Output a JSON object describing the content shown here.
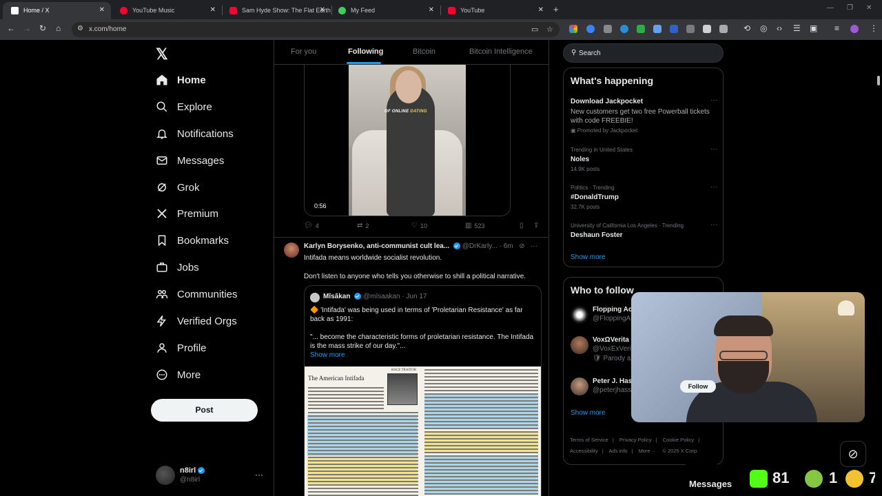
{
  "browser": {
    "tabs": [
      {
        "label": "Home / X",
        "icon": "x-logo-icon",
        "color": "#ffffff"
      },
      {
        "label": "YouTube Music",
        "icon": "youtube-music-icon",
        "color": "#ff0033"
      },
      {
        "label": "Sam Hyde Show: The Flat Earth",
        "icon": "youtube-icon",
        "color": "#ff0033"
      },
      {
        "label": "My Feed",
        "icon": "feed-play-icon",
        "color": "#3ecf5a"
      },
      {
        "label": "YouTube",
        "icon": "youtube-icon",
        "color": "#ff0033"
      }
    ],
    "new_tab": "+",
    "url": "x.com/home"
  },
  "sidebar": {
    "logo": "𝕏",
    "items": [
      {
        "label": "Home",
        "icon": "home-icon"
      },
      {
        "label": "Explore",
        "icon": "search-icon"
      },
      {
        "label": "Notifications",
        "icon": "bell-icon"
      },
      {
        "label": "Messages",
        "icon": "envelope-icon"
      },
      {
        "label": "Grok",
        "icon": "grok-icon"
      },
      {
        "label": "Premium",
        "icon": "x-premium-icon"
      },
      {
        "label": "Bookmarks",
        "icon": "bookmark-icon"
      },
      {
        "label": "Jobs",
        "icon": "briefcase-icon"
      },
      {
        "label": "Communities",
        "icon": "people-icon"
      },
      {
        "label": "Verified Orgs",
        "icon": "lightning-icon"
      },
      {
        "label": "Profile",
        "icon": "person-icon"
      },
      {
        "label": "More",
        "icon": "more-circle-icon"
      }
    ],
    "post_label": "Post",
    "account": {
      "name": "n8irl",
      "handle": "@n8irl",
      "more": "···"
    }
  },
  "feed": {
    "tabs": [
      "For you",
      "Following",
      "Bitcoin",
      "Bitcoin Intelligence"
    ],
    "active_tab": "Following",
    "video_tweet": {
      "caption_prefix": "OF ONLINE ",
      "caption_highlight": "DATING",
      "duration": "0:56",
      "replies": "4",
      "reposts": "2",
      "likes": "10",
      "views": "523"
    },
    "tweet2": {
      "name": "Karlyn Borysenko, anti-communist cult lea...",
      "handle": "@DrKarly...",
      "time": "· 6m",
      "text1": "Intifada means worldwide socialist revolution.",
      "text2": "Don't listen to anyone who tells you otherwise to shill a political narrative.",
      "quote": {
        "name": "Mīsākan",
        "handle": "@mīsaakan",
        "date": "· Jun 17",
        "text1": "🔶 'Intifada' was being used in terms of 'Proletarian Resistance' as far back as 1991:",
        "text2": "\"... become the characteristic forms of proletarian resistance. The Intifada is the mass strike of our day.\"...",
        "show_more": "Show more",
        "doc_title": "The American Intifada",
        "doc_caption": "RACE TRAITOR"
      }
    }
  },
  "right": {
    "search_placeholder": "Search",
    "happening_title": "What's happening",
    "trends": [
      {
        "small": "",
        "big": "Download Jackpocket",
        "desc": "New customers get two free Powerball tickets with code FREEBIE!",
        "promo": "Promoted by Jackpocket"
      },
      {
        "small": "Trending in United States",
        "big": "Noles",
        "desc": "14.9K posts"
      },
      {
        "small": "Politics · Trending",
        "big": "#DonaldTrump",
        "desc": "32.7K posts"
      },
      {
        "small": "University of California Los Angeles · Trending",
        "big": "Deshaun Foster",
        "desc": ""
      }
    ],
    "show_more": "Show more",
    "who_title": "Who to follow",
    "follows": [
      {
        "name": "Flopping Ac",
        "handle": "@FloppingA",
        "extra": ""
      },
      {
        "name": "VoxΩVerita",
        "handle": "@VoxExVeri",
        "extra": "🛡 Parody a"
      },
      {
        "name": "Peter J. Hass",
        "handle": "@peterjhasson",
        "extra": ""
      }
    ],
    "follow_label": "Follow",
    "footer": [
      "Terms of Service",
      "|",
      "Privacy Policy",
      "|",
      "Cookie Policy",
      "|",
      "Accessibility",
      "|",
      "Ads info",
      "|",
      "More ···",
      "© 2025 X Corp."
    ]
  },
  "overlay": {
    "messages_label": "Messages",
    "stat_kick": "81",
    "stat_rumble": "1",
    "stat_other": "7"
  }
}
